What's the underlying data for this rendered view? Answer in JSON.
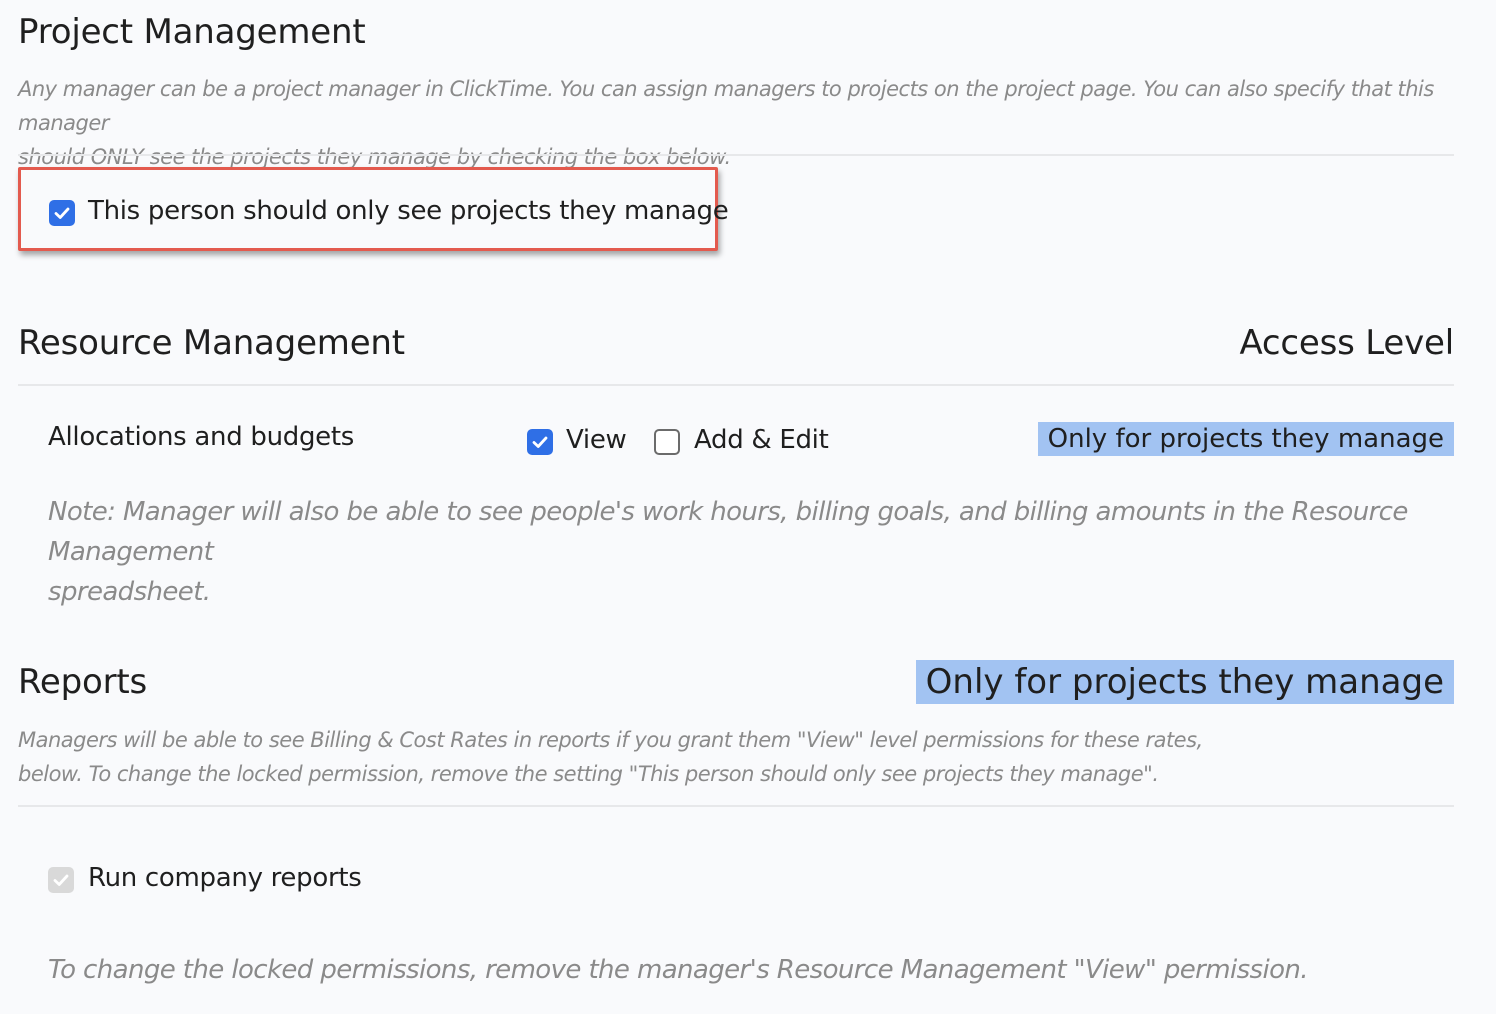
{
  "project_management": {
    "title": "Project Management",
    "description_line1": "Any manager can be a project manager in ClickTime. You can assign managers to projects on the project page. You can also specify that this manager",
    "description_line2": "should ONLY see the projects they manage by checking the box below.",
    "only_own_projects_checkbox": {
      "label": "This person should only see projects they manage",
      "checked": true
    }
  },
  "resource_management": {
    "title": "Resource Management",
    "access_level_header": "Access Level",
    "allocations": {
      "label": "Allocations and budgets",
      "view_label": "View",
      "view_checked": true,
      "add_edit_label": "Add & Edit",
      "add_edit_checked": false,
      "access_level": "Only for projects they manage"
    },
    "note_line1": "Note: Manager will also be able to see people's work hours, billing goals, and billing amounts in the Resource Management",
    "note_line2": "spreadsheet."
  },
  "reports": {
    "title": "Reports",
    "access_level": "Only for projects they manage",
    "description_line1": "Managers will be able to see Billing & Cost Rates in reports if you grant them \"View\" level permissions for these rates,",
    "description_line2": "below. To change the locked permission, remove the setting \"This person should only see projects they manage\".",
    "run_company_reports": {
      "label": "Run company reports",
      "checked": true,
      "disabled": true
    },
    "locked_note": "To change the locked permissions, remove the manager's Resource Management \"View\" permission."
  },
  "colors": {
    "checkbox_checked": "#2f6fe6",
    "highlight_border": "#e35a4e",
    "access_badge": "#a2c3f2"
  }
}
